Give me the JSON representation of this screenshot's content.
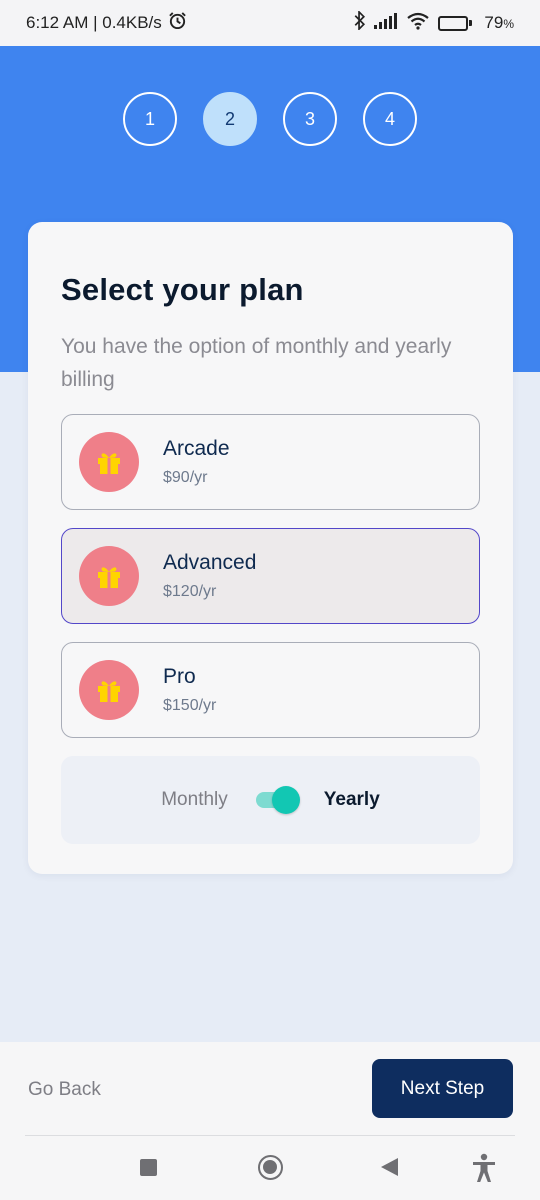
{
  "status_bar": {
    "time_and_speed": "6:12 AM | 0.4KB/s",
    "battery_percent": "79",
    "battery_unit": "%",
    "battery_level": 0.79
  },
  "steps": [
    {
      "label": "1",
      "active": false
    },
    {
      "label": "2",
      "active": true
    },
    {
      "label": "3",
      "active": false
    },
    {
      "label": "4",
      "active": false
    }
  ],
  "card": {
    "title": "Select your plan",
    "subtitle": "You have the option of monthly and yearly billing"
  },
  "plans": [
    {
      "name": "Arcade",
      "price": "$90/yr",
      "icon": "gift-icon",
      "selected": false
    },
    {
      "name": "Advanced",
      "price": "$120/yr",
      "icon": "gift-icon",
      "selected": true
    },
    {
      "name": "Pro",
      "price": "$150/yr",
      "icon": "gift-icon",
      "selected": false
    }
  ],
  "billing": {
    "monthly_label": "Monthly",
    "yearly_label": "Yearly",
    "yearly_selected": true
  },
  "footer": {
    "back_label": "Go Back",
    "next_label": "Next Step"
  },
  "colors": {
    "hero_blue": "#3f84ef",
    "navy": "#0e2d5f",
    "plan_icon_bg": "#ef7f89",
    "gift_yellow": "#ffd400",
    "toggle_teal": "#12c7b3",
    "selected_border": "#5347c9"
  }
}
